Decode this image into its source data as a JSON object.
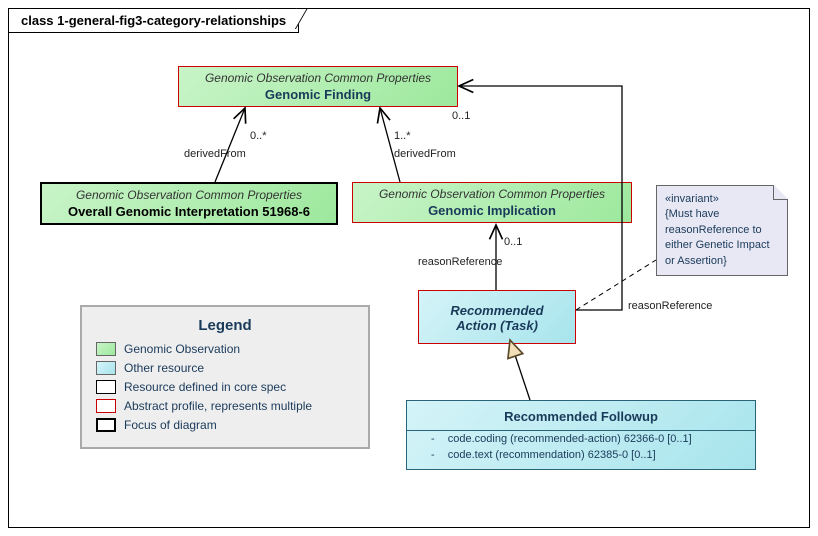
{
  "frame_title": "class 1-general-fig3-category-relationships",
  "boxes": {
    "genomicFinding": {
      "stereo": "Genomic Observation Common Properties",
      "title": "Genomic Finding"
    },
    "overallInterp": {
      "stereo": "Genomic Observation Common Properties",
      "title": "Overall Genomic Interpretation 51968-6"
    },
    "genomicImplication": {
      "stereo": "Genomic Observation Common Properties",
      "title": "Genomic Implication"
    },
    "recAction": {
      "title": "Recommended Action (Task)"
    },
    "recFollowup": {
      "title": "Recommended Followup",
      "attrs": [
        "code.coding (recommended-action) 62366-0 [0..1]",
        "code.text (recommendation) 62385-0 [0..1]"
      ]
    }
  },
  "note": {
    "stereo": "«invariant»",
    "text": "{Must have reasonReference to either Genetic Impact or Assertion}"
  },
  "labels": {
    "derivedFrom1": "derivedFrom",
    "derivedFrom2": "derivedFrom",
    "mult1": "0..*",
    "mult2": "1..*",
    "reasonRef1": "reasonReference",
    "reasonRef2": "reasonReference",
    "mult3": "0..1",
    "mult4": "0..1"
  },
  "legend": {
    "title": "Legend",
    "rows": [
      {
        "swatch": "sw-green",
        "label": "Genomic Observation"
      },
      {
        "swatch": "sw-cyan",
        "label": "Other resource"
      },
      {
        "swatch": "sw-core",
        "label": "Resource defined in core spec"
      },
      {
        "swatch": "sw-abs",
        "label": "Abstract profile, represents multiple"
      },
      {
        "swatch": "sw-focus",
        "label": "Focus of diagram"
      }
    ]
  }
}
